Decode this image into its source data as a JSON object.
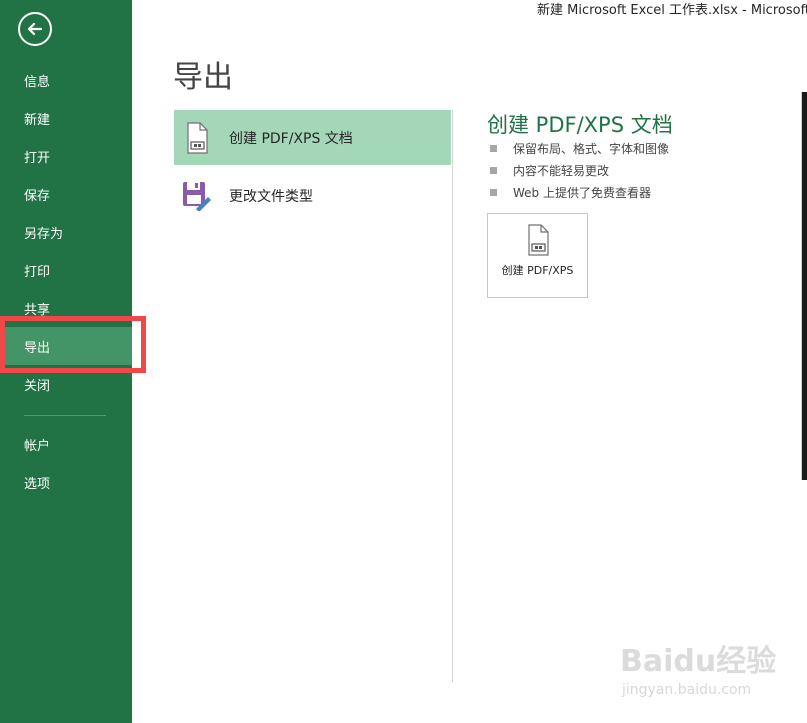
{
  "window": {
    "title": "新建 Microsoft Excel 工作表.xlsx - Microsoft Exc"
  },
  "sidebar": {
    "back_icon": "back-arrow-icon",
    "items": [
      {
        "label": "信息"
      },
      {
        "label": "新建"
      },
      {
        "label": "打开"
      },
      {
        "label": "保存"
      },
      {
        "label": "另存为"
      },
      {
        "label": "打印"
      },
      {
        "label": "共享"
      },
      {
        "label": "导出",
        "active": true
      },
      {
        "label": "关闭"
      },
      {
        "label": "帐户"
      },
      {
        "label": "选项"
      }
    ]
  },
  "main": {
    "title": "导出",
    "options": [
      {
        "label": "创建 PDF/XPS 文档",
        "icon": "pdf-document-icon",
        "selected": true
      },
      {
        "label": "更改文件类型",
        "icon": "save-file-type-icon",
        "selected": false
      }
    ],
    "detail": {
      "title": "创建 PDF/XPS 文档",
      "bullets": [
        "保留布局、格式、字体和图像",
        "内容不能轻易更改",
        "Web 上提供了免费查看器"
      ],
      "button_label": "创建 PDF/XPS"
    }
  },
  "watermark": {
    "text": "Baidu经验",
    "sub": "jingyan.baidu.com"
  },
  "colors": {
    "sidebar_bg": "#217346",
    "sidebar_active": "#439467",
    "option_selected": "#a3d7b8",
    "accent_title": "#217346",
    "highlight_border": "#f04848"
  }
}
